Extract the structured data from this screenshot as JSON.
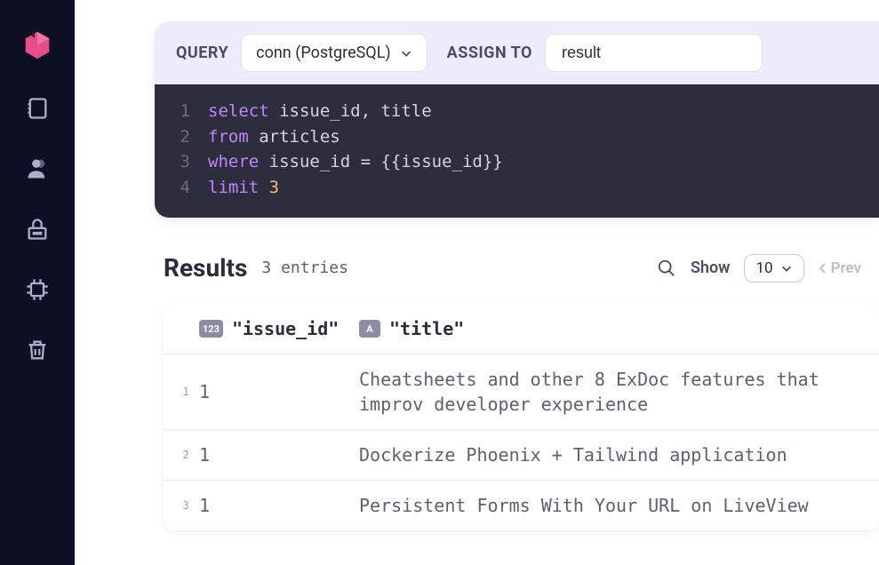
{
  "query": {
    "label": "QUERY",
    "connection": "conn (PostgreSQL)",
    "assign_label": "ASSIGN TO",
    "assign_value": "result"
  },
  "code": {
    "lines": [
      {
        "n": "1",
        "html": "<span class='kw'>select</span> issue_id, title"
      },
      {
        "n": "2",
        "html": "<span class='kw'>from</span> articles"
      },
      {
        "n": "3",
        "html": "<span class='kw'>where</span> issue_id = {{issue_id}}"
      },
      {
        "n": "4",
        "html": "<span class='kw'>limit</span> <span class='num'>3</span>"
      }
    ]
  },
  "results": {
    "title": "Results",
    "entries_text": "3 entries",
    "show_label": "Show",
    "show_value": "10",
    "prev_label": "Prev",
    "columns": [
      {
        "badge": "123",
        "name": "\"issue_id\""
      },
      {
        "badge": "A",
        "name": "\"title\""
      }
    ],
    "rows": [
      {
        "n": "1",
        "issue_id": "1",
        "title": "Cheatsheets and other 8 ExDoc features that improv developer experience"
      },
      {
        "n": "2",
        "issue_id": "1",
        "title": "Dockerize Phoenix + Tailwind application"
      },
      {
        "n": "3",
        "issue_id": "1",
        "title": "Persistent Forms With Your URL on LiveView"
      }
    ]
  }
}
